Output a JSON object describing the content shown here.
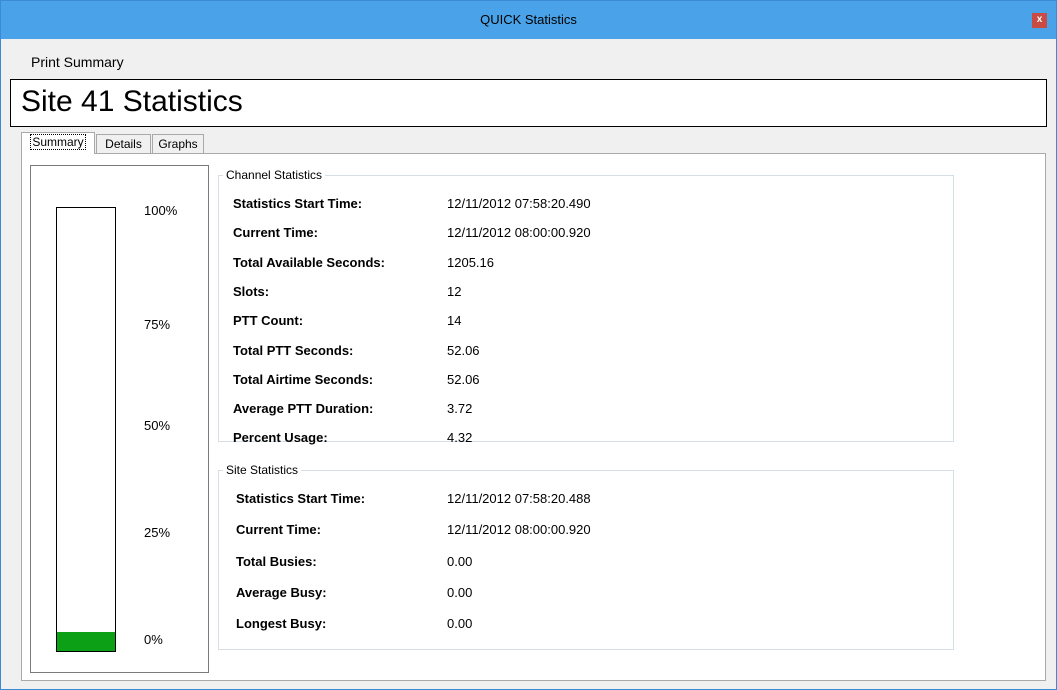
{
  "window": {
    "title": "QUICK Statistics",
    "close_glyph": "x"
  },
  "menu": {
    "print_summary": "Print Summary"
  },
  "heading": "Site 41 Statistics",
  "tabs": [
    {
      "label": "Summary",
      "active": true
    },
    {
      "label": "Details",
      "active": false
    },
    {
      "label": "Graphs",
      "active": false
    }
  ],
  "gauge": {
    "labels": [
      "100%",
      "75%",
      "50%",
      "25%",
      "0%"
    ],
    "fill_percent": 4.32,
    "fill_color": "#0ca017"
  },
  "channel_statistics": {
    "title": "Channel Statistics",
    "rows": [
      {
        "label": "Statistics Start Time:",
        "value": "12/11/2012 07:58:20.490"
      },
      {
        "label": "Current Time:",
        "value": "12/11/2012 08:00:00.920"
      },
      {
        "label": "Total Available Seconds:",
        "value": "1205.16"
      },
      {
        "label": "Slots:",
        "value": "12"
      },
      {
        "label": "PTT Count:",
        "value": "14"
      },
      {
        "label": "Total PTT Seconds:",
        "value": "52.06"
      },
      {
        "label": "Total Airtime Seconds:",
        "value": "52.06"
      },
      {
        "label": "Average PTT Duration:",
        "value": "3.72"
      },
      {
        "label": "Percent Usage:",
        "value": "4.32"
      }
    ]
  },
  "site_statistics": {
    "title": "Site Statistics",
    "rows": [
      {
        "label": "Statistics Start Time:",
        "value": "12/11/2012 07:58:20.488"
      },
      {
        "label": "Current Time:",
        "value": "12/11/2012 08:00:00.920"
      },
      {
        "label": "Total Busies:",
        "value": "0.00"
      },
      {
        "label": "Average Busy:",
        "value": "0.00"
      },
      {
        "label": "Longest Busy:",
        "value": "0.00"
      }
    ]
  }
}
